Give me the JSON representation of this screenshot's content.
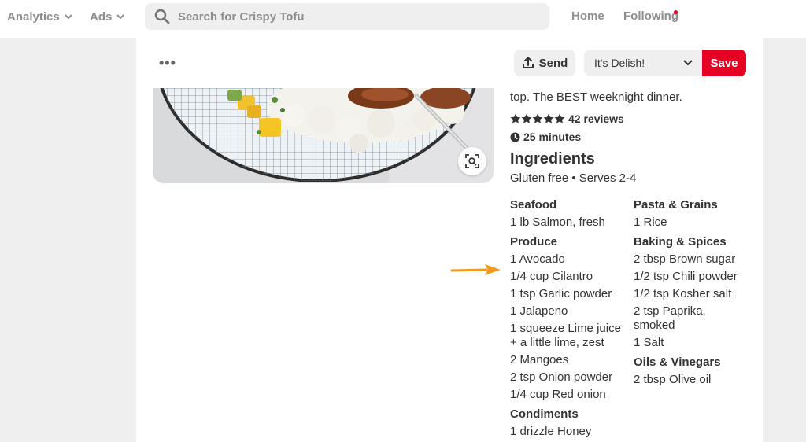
{
  "nav": {
    "analytics": "Analytics",
    "ads": "Ads",
    "search_placeholder": "Search for Crispy Tofu",
    "home": "Home",
    "following": "Following"
  },
  "toolbar": {
    "more": "•••",
    "send": "Send",
    "board": "It's Delish!",
    "save": "Save"
  },
  "recipe": {
    "description": "top. The BEST weeknight dinner.",
    "rating": 5,
    "reviews": "42 reviews",
    "time": "25 minutes",
    "ingredients_title": "Ingredients",
    "ingredients_sub": "Gluten free • Serves 2-4",
    "left_column": [
      {
        "category": "Seafood",
        "items": [
          "1 lb Salmon, fresh"
        ]
      },
      {
        "category": "Produce",
        "items": [
          "1 Avocado",
          "1/4 cup Cilantro",
          "1 tsp Garlic powder",
          "1 Jalapeno",
          "1 squeeze Lime juice + a little lime, zest",
          "2 Mangoes",
          "2 tsp Onion powder",
          "1/4 cup Red onion"
        ]
      },
      {
        "category": "Condiments",
        "items": [
          "1 drizzle Honey"
        ]
      }
    ],
    "right_column": [
      {
        "category": "Pasta & Grains",
        "items": [
          "1 Rice"
        ]
      },
      {
        "category": "Baking & Spices",
        "items": [
          "2 tbsp Brown sugar",
          "1/2 tsp Chili powder",
          "1/2 tsp Kosher salt",
          "2 tsp Paprika, smoked",
          "1 Salt"
        ]
      },
      {
        "category": "Oils & Vinegars",
        "items": [
          "2 tbsp Olive oil"
        ]
      }
    ]
  },
  "colors": {
    "save_red": "#e60023",
    "arrow_orange": "#f39a1e",
    "notification_dot": "#e60023"
  },
  "icons": {
    "search": "search-icon",
    "chevron": "chevron-down-icon",
    "send": "share-upload-icon",
    "lens": "visual-search-lens-icon",
    "clock": "clock-icon",
    "star": "star-icon",
    "arrow": "annotation-arrow-icon"
  }
}
